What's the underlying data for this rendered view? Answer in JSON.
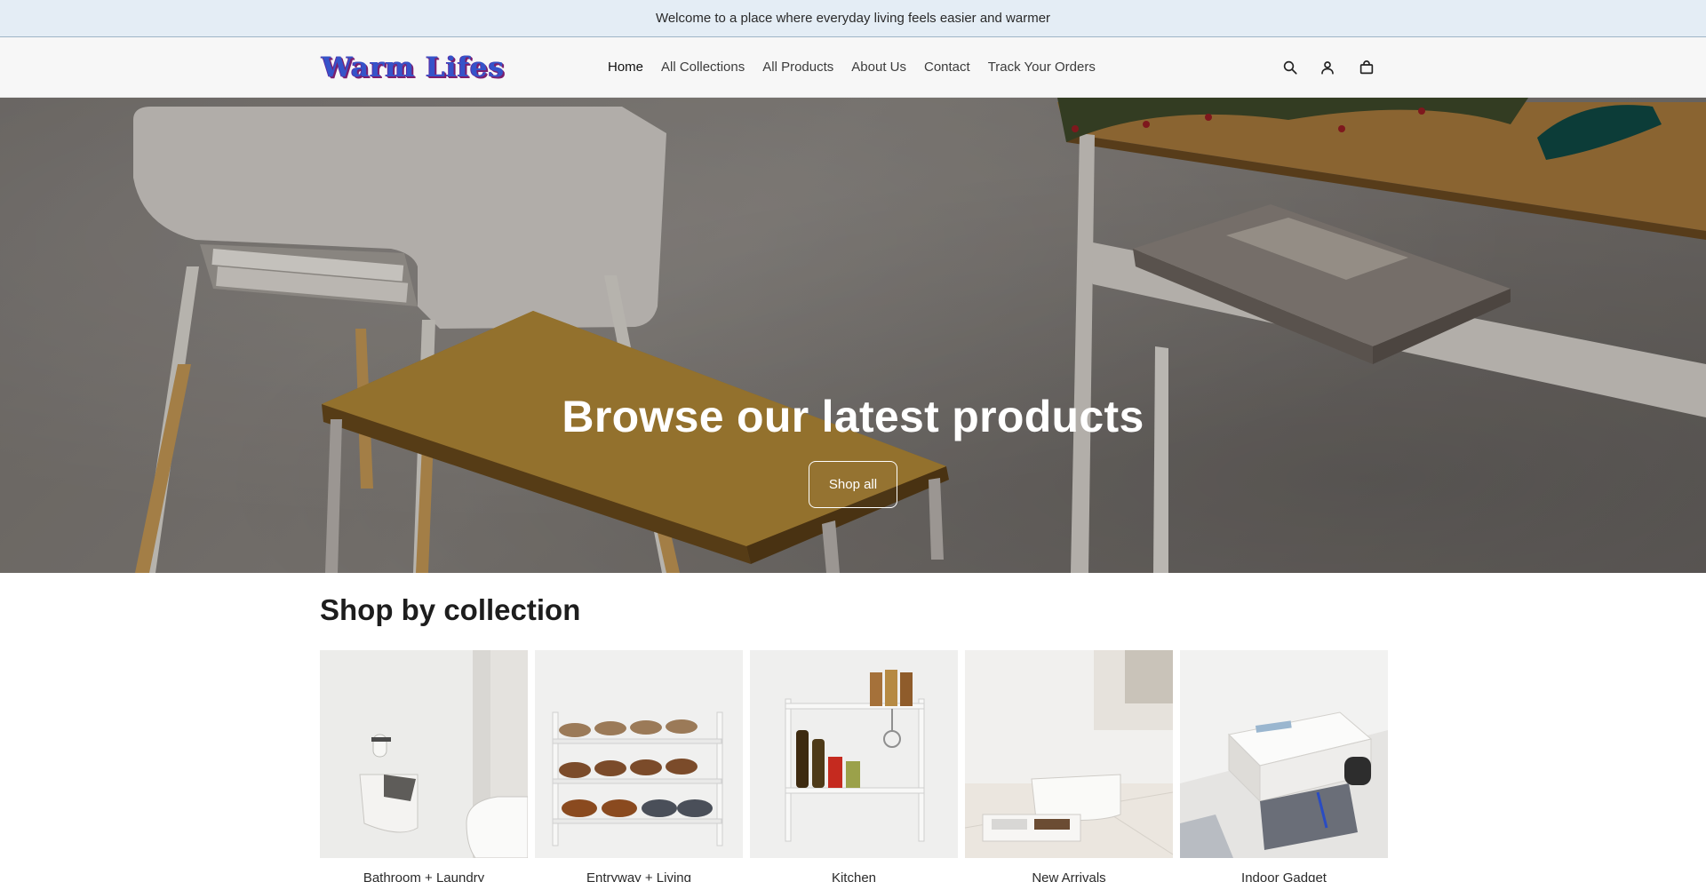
{
  "announcement": {
    "text": "Welcome to a place where everyday living feels easier and warmer"
  },
  "header": {
    "logo_text": "Warm Lifes",
    "nav": [
      {
        "label": "Home",
        "active": true
      },
      {
        "label": "All Collections"
      },
      {
        "label": "All Products"
      },
      {
        "label": "About Us"
      },
      {
        "label": "Contact"
      },
      {
        "label": "Track Your Orders"
      }
    ],
    "icons": [
      "search-icon",
      "account-icon",
      "cart-icon"
    ]
  },
  "hero": {
    "title": "Browse our latest products",
    "button_label": "Shop all"
  },
  "collections": {
    "title": "Shop by collection",
    "items": [
      {
        "label": "Bathroom + Laundry"
      },
      {
        "label": "Entryway + Living"
      },
      {
        "label": "Kitchen"
      },
      {
        "label": "New Arrivals"
      },
      {
        "label": "Indoor Gadget"
      }
    ]
  },
  "colors": {
    "announcement_bg": "#e4edf5",
    "header_bg": "#f7f7f7",
    "logo_primary": "#3553c9",
    "logo_shadow": "#7b1f6e"
  }
}
